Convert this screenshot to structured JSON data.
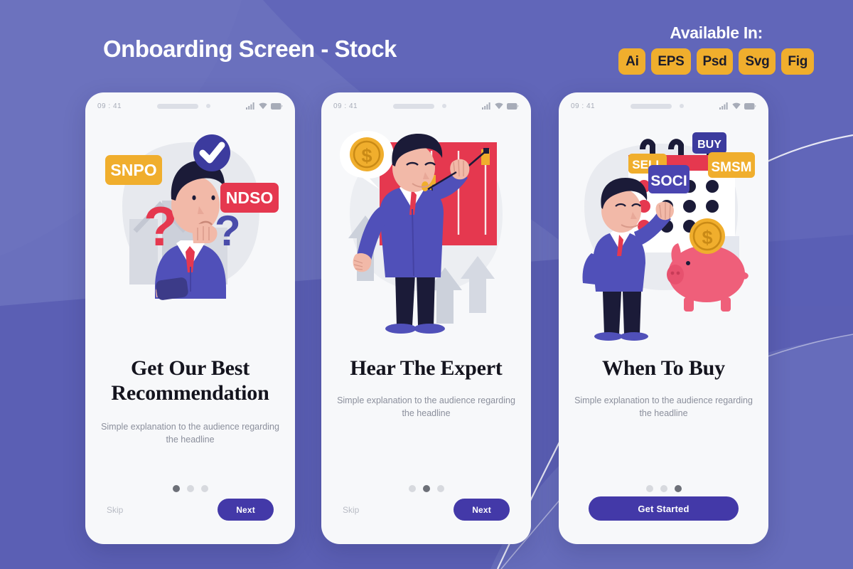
{
  "header": {
    "title": "Onboarding Screen - Stock",
    "available_label": "Available In:",
    "badges": [
      "Ai",
      "EPS",
      "Psd",
      "Svg",
      "Fig"
    ]
  },
  "theme": {
    "background": "#6a70bd",
    "background_dark": "#5b5fb4",
    "card": "#f7f8fa",
    "accent_indigo": "#4339a8",
    "accent_amber": "#f0ae2d",
    "accent_red": "#e5384f",
    "suit_blue": "#5050b9",
    "hair_navy": "#1b1b38",
    "skin": "#f2b9a8",
    "piggy_pink": "#ef5f7a",
    "text_dark": "#14141e",
    "text_muted": "#8b8f9c",
    "dot_active": "#6d7078",
    "dot_inactive": "#d7d9de"
  },
  "status_bar": {
    "time": "09 : 41",
    "icons": [
      "signal-icon",
      "wifi-icon",
      "battery-icon"
    ]
  },
  "screens": [
    {
      "id": "screen-1",
      "headline": "Get Our Best Recommendation",
      "subtitle": "Simple explanation to the audience regarding the headline",
      "illustration": {
        "name": "confused-investor-illustration",
        "tags": [
          {
            "text": "SNPO",
            "color": "#f0ae2d"
          },
          {
            "text": "NDSO",
            "color": "#e5384f"
          }
        ],
        "symbols": [
          "question-mark-red",
          "question-mark-blue",
          "checkmark-badge"
        ]
      },
      "dots": {
        "count": 3,
        "active": 0
      },
      "skip_label": "Skip",
      "button_label": "Next",
      "button_style": "pill"
    },
    {
      "id": "screen-2",
      "headline": "Hear The Expert",
      "subtitle": "Simple explanation to the audience regarding the headline",
      "illustration": {
        "name": "expert-presenting-chart-illustration",
        "tags": [],
        "symbols": [
          "dollar-coin-bubble",
          "candlestick-chart",
          "up-arrows"
        ]
      },
      "dots": {
        "count": 3,
        "active": 1
      },
      "skip_label": "Skip",
      "button_label": "Next",
      "button_style": "pill"
    },
    {
      "id": "screen-3",
      "headline": "When To Buy",
      "subtitle": "Simple explanation to the audience regarding the headline",
      "illustration": {
        "name": "calendar-buy-sell-illustration",
        "tags": [
          {
            "text": "SELL",
            "color": "#f0ae2d"
          },
          {
            "text": "SOCI",
            "color": "#4339a8"
          },
          {
            "text": "BUY",
            "color": "#4339a8"
          },
          {
            "text": "SMSM",
            "color": "#f0ae2d"
          }
        ],
        "symbols": [
          "piggy-bank",
          "dollar-coin",
          "calendar"
        ]
      },
      "dots": {
        "count": 3,
        "active": 2
      },
      "skip_label": "",
      "button_label": "Get Started",
      "button_style": "wide"
    }
  ]
}
